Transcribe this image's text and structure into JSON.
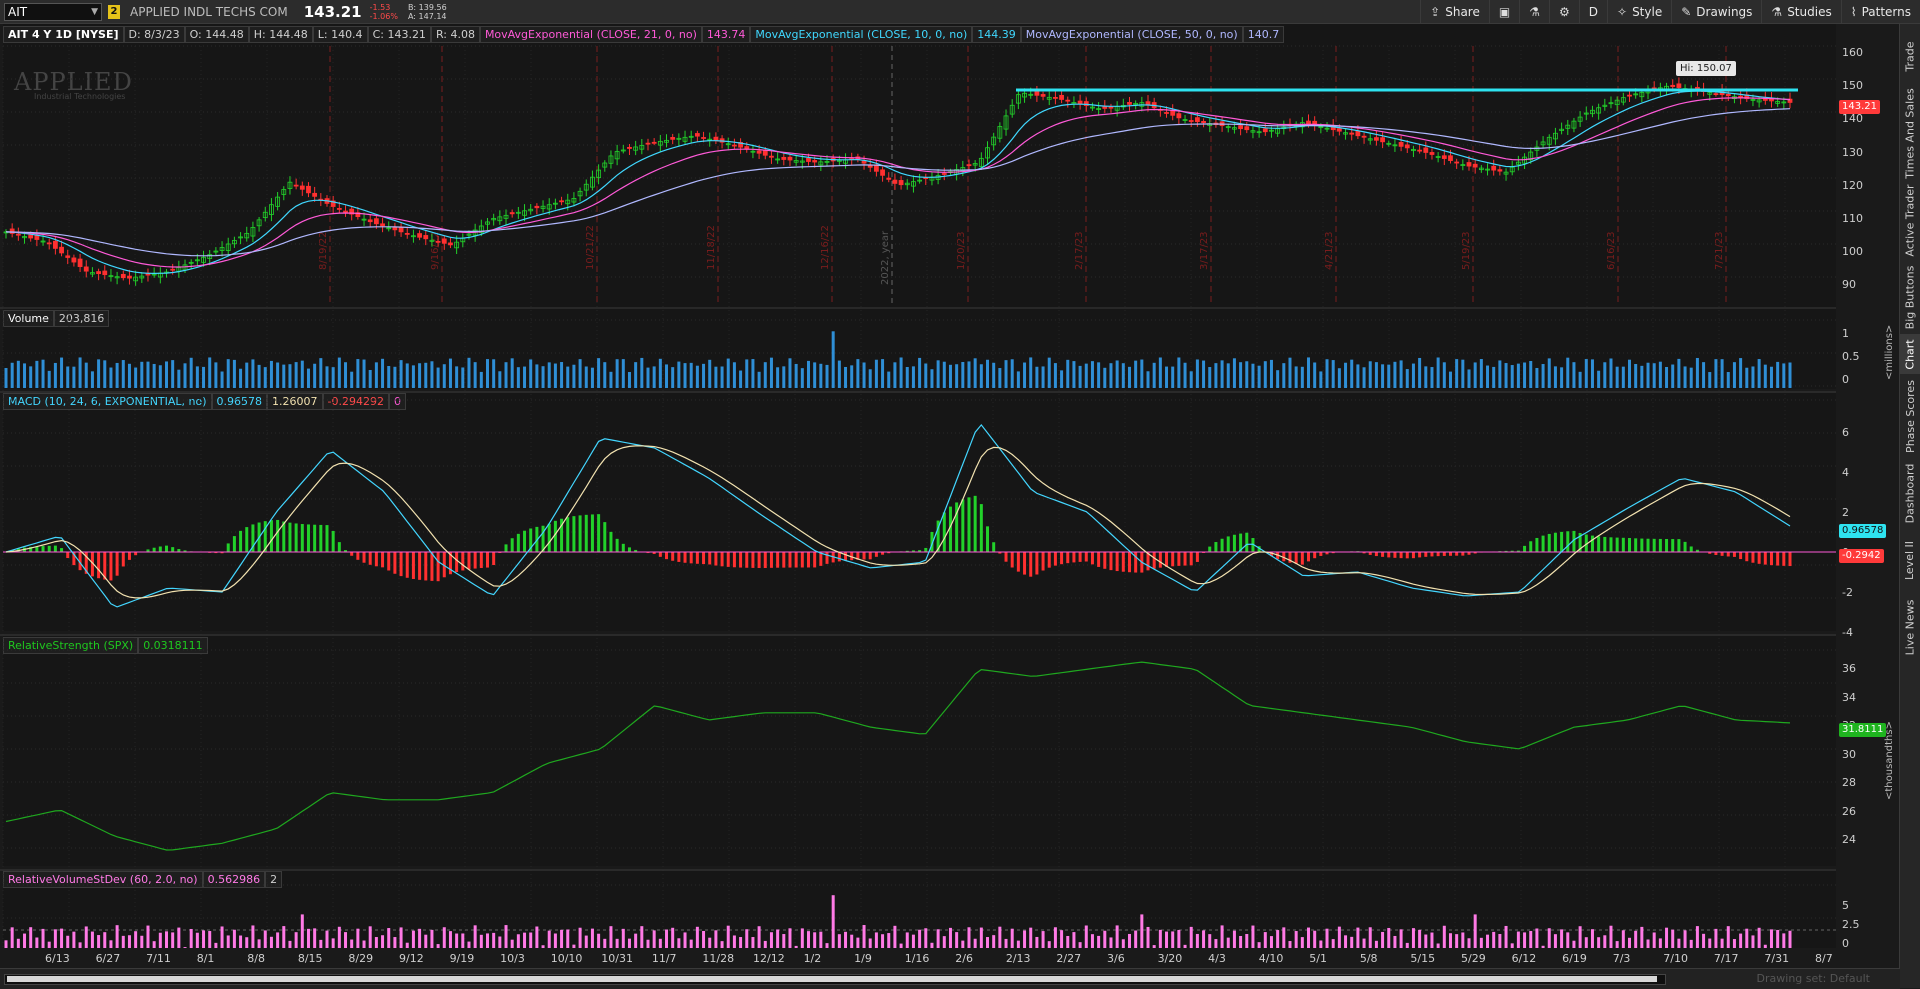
{
  "header": {
    "symbol": "AIT",
    "link_number": "2",
    "company": "APPLIED INDL TECHS COM",
    "last": "143.21",
    "change": "-1.53",
    "change_pct": "-1.06%",
    "bid": "B: 139.56",
    "ask": "A: 147.14",
    "buttons": [
      {
        "label": "Share",
        "icon": "share-icon"
      },
      {
        "label": "",
        "icon": "screenshot-icon"
      },
      {
        "label": "",
        "icon": "flask-icon"
      },
      {
        "label": "",
        "icon": "gear-icon"
      },
      {
        "label": "D",
        "icon": ""
      },
      {
        "label": "Style",
        "icon": "style-icon"
      },
      {
        "label": "Drawings",
        "icon": "pencil-icon"
      },
      {
        "label": "Studies",
        "icon": "studies-icon"
      },
      {
        "label": "Patterns",
        "icon": "patterns-icon"
      }
    ]
  },
  "price_pane": {
    "title": "AIT 4 Y 1D [NYSE]",
    "date": "D: 8/3/23",
    "open": "O: 144.48",
    "high": "H: 144.48",
    "low": "L: 140.4",
    "close": "C: 143.21",
    "range": "R: 4.08",
    "studies": [
      {
        "label": "MovAvgExponential (CLOSE, 21, 0, no)",
        "value": "143.74",
        "color": "#ff5ad8"
      },
      {
        "label": "MovAvgExponential (CLOSE, 10, 0, no)",
        "value": "144.39",
        "color": "#40d8ff"
      },
      {
        "label": "MovAvgExponential (CLOSE, 50, 0, no)",
        "value": "140.7",
        "color": "#b0b8ff"
      }
    ],
    "scale": [
      "160",
      "150",
      "140",
      "130",
      "120",
      "110",
      "100",
      "90"
    ],
    "high_bubble": "Hi: 150.07",
    "last_tag": "143.21",
    "logo": "APPLIED",
    "logo_sub": "Industrial Technologies",
    "year_marker": "2022, year",
    "event_labels": [
      "8/19/22",
      "9/16/22",
      "10/21/22",
      "11/18/22",
      "12/16/22",
      "1/20/23",
      "2/17/23",
      "3/17/23",
      "4/21/23",
      "5/19/23",
      "6/16/23",
      "7/21/23"
    ]
  },
  "volume_pane": {
    "title": "Volume",
    "value": "203,816",
    "scale": [
      "1",
      "0.5",
      "0"
    ],
    "unit": "<millions>"
  },
  "macd_pane": {
    "title": "MACD (10, 24, 6, EXPONENTIAL, no)",
    "value": "0.96578",
    "avg": "1.26007",
    "diff": "-0.294292",
    "zero": "0",
    "scale": [
      "6",
      "4",
      "2",
      "0",
      "-2",
      "-4"
    ],
    "value_tag": "0.96578",
    "diff_tag": "-0.2942"
  },
  "rs_pane": {
    "title": "RelativeStrength (SPX)",
    "value": "0.0318111",
    "scale": [
      "36",
      "34",
      "32",
      "30",
      "28",
      "26",
      "24"
    ],
    "tag": "31.8111",
    "unit": "<thousandths>"
  },
  "rv_pane": {
    "title": "RelativeVolumeStDev (60, 2.0, no)",
    "value": "0.562986",
    "extra": "2",
    "scale": [
      "5",
      "2.5",
      "0"
    ]
  },
  "x_axis": [
    "6/13",
    "6/27",
    "7/11",
    "8/1",
    "8/8",
    "8/15",
    "8/29",
    "9/12",
    "9/19",
    "10/3",
    "10/10",
    "10/31",
    "11/7",
    "11/28",
    "12/12",
    "1/2",
    "1/9",
    "1/16",
    "2/6",
    "2/13",
    "2/27",
    "3/6",
    "3/20",
    "4/3",
    "4/10",
    "5/1",
    "5/8",
    "5/15",
    "5/29",
    "6/12",
    "6/19",
    "7/3",
    "7/10",
    "7/17",
    "7/31",
    "8/7"
  ],
  "right_tabs": [
    "Trade",
    "Times And Sales",
    "Active Trader",
    "Big Buttons",
    "Chart",
    "Phase Scores",
    "Dashboard",
    "Level II",
    "Live News"
  ],
  "active_tab": "Chart",
  "drawing_set": "Drawing set: Default",
  "colors": {
    "up": "#22d12a",
    "down": "#ff3030",
    "ema10": "#40d8ff",
    "ema21": "#ff5ad8",
    "ema50": "#b0b8ff",
    "resistance": "#2ee3f0",
    "volume": "#2f8fd6",
    "macd": "#43d6ff",
    "macd_avg": "#f2e2b0",
    "rs": "#1fa81f",
    "rv": "#ff7ae6"
  }
}
